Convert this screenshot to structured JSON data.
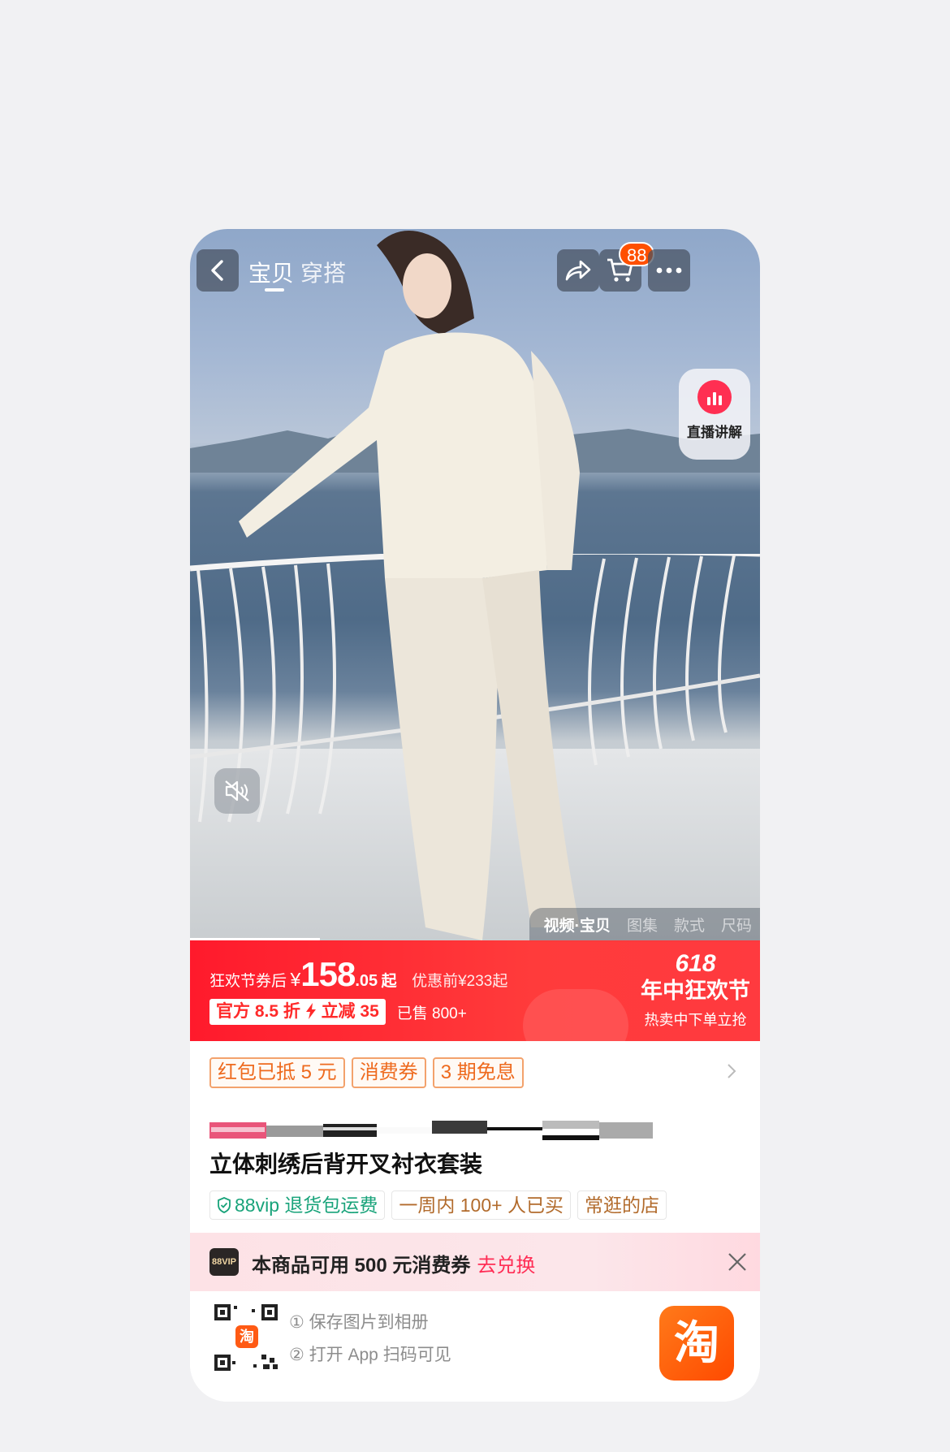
{
  "topbar": {
    "tabs": [
      "宝贝",
      "穿搭"
    ],
    "cart_count": "88"
  },
  "live": {
    "label": "直播讲解"
  },
  "media_tabs": [
    "视频·宝贝",
    "图集",
    "款式",
    "尺码"
  ],
  "promo": {
    "prefix": "狂欢节券后",
    "currency": "¥",
    "price_int": "158",
    "price_dec": ".05",
    "price_suffix": "起",
    "prev_price": "优惠前¥233起",
    "discount_tag": "官方 8.5 折",
    "discount_tag2": "立减 35",
    "sold": "已售 800+",
    "fest_number": "618",
    "fest_name": "年中狂欢节",
    "fest_sub": "热卖中下单立抢"
  },
  "coupons": [
    "红包已抵 5 元",
    "消费券",
    "3 期免息"
  ],
  "product": {
    "title": "立体刺绣后背开叉衬衣套装"
  },
  "services": [
    "88vip 退货包运费",
    "一周内 100+ 人已买",
    "常逛的店"
  ],
  "vip_bar": {
    "logo": "88VIP",
    "text": "本商品可用 500 元消费券",
    "link": "去兑换"
  },
  "qr": {
    "step1": "① 保存图片到相册",
    "step2": "② 打开 App 扫码可见",
    "app_icon": "淘"
  },
  "colors": {
    "brand_orange": "#ff5000",
    "promo_red": "#ff1a2c",
    "coupon_orange": "#ee6a1e",
    "vip_pink": "#ff2d55"
  }
}
